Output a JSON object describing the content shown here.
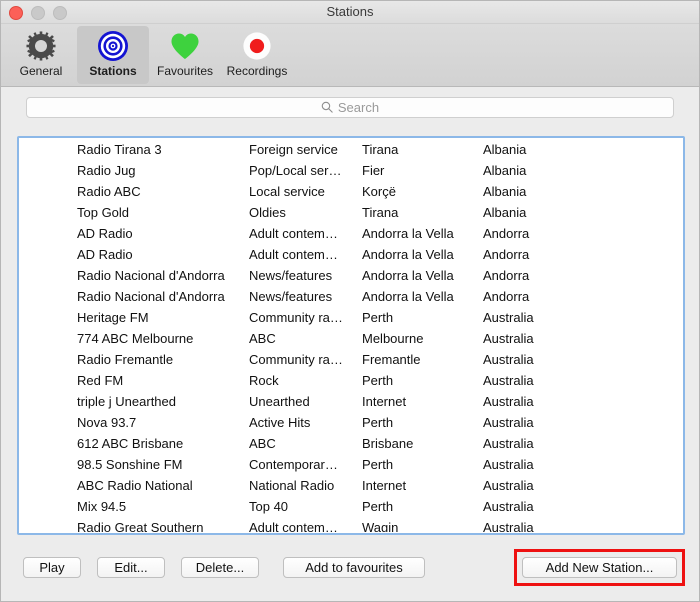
{
  "window": {
    "title": "Stations",
    "traffic_lights": [
      "close-button",
      "minimize-button",
      "zoom-button"
    ]
  },
  "toolbar": {
    "items": [
      {
        "label": "General",
        "icon": "gear-icon",
        "selected": false
      },
      {
        "label": "Stations",
        "icon": "bullseye-icon",
        "selected": true
      },
      {
        "label": "Favourites",
        "icon": "heart-icon",
        "selected": false
      },
      {
        "label": "Recordings",
        "icon": "record-dot-icon",
        "selected": false
      }
    ]
  },
  "search": {
    "icon": "search-icon",
    "placeholder": "Search",
    "value": ""
  },
  "table": {
    "rows": [
      {
        "name": "Radio Tirana 3",
        "genre": "Foreign service",
        "city": "Tirana",
        "country": "Albania"
      },
      {
        "name": "Radio Jug",
        "genre": "Pop/Local ser…",
        "city": "Fier",
        "country": "Albania"
      },
      {
        "name": "Radio ABC",
        "genre": "Local service",
        "city": "Korçë",
        "country": "Albania"
      },
      {
        "name": "Top Gold",
        "genre": "Oldies",
        "city": "Tirana",
        "country": "Albania"
      },
      {
        "name": "AD Radio",
        "genre": "Adult contem…",
        "city": "Andorra la Vella",
        "country": "Andorra"
      },
      {
        "name": "AD Radio",
        "genre": "Adult contem…",
        "city": "Andorra la Vella",
        "country": "Andorra"
      },
      {
        "name": "Radio Nacional d'Andorra",
        "genre": "News/features",
        "city": "Andorra la Vella",
        "country": "Andorra"
      },
      {
        "name": "Radio Nacional d'Andorra",
        "genre": "News/features",
        "city": "Andorra la Vella",
        "country": "Andorra"
      },
      {
        "name": "Heritage FM",
        "genre": "Community ra…",
        "city": "Perth",
        "country": "Australia"
      },
      {
        "name": "774 ABC Melbourne",
        "genre": "ABC",
        "city": "Melbourne",
        "country": "Australia"
      },
      {
        "name": "Radio Fremantle",
        "genre": "Community ra…",
        "city": "Fremantle",
        "country": "Australia"
      },
      {
        "name": "Red FM",
        "genre": "Rock",
        "city": "Perth",
        "country": "Australia"
      },
      {
        "name": "triple j Unearthed",
        "genre": "Unearthed",
        "city": "Internet",
        "country": "Australia"
      },
      {
        "name": "Nova 93.7",
        "genre": "Active Hits",
        "city": "Perth",
        "country": "Australia"
      },
      {
        "name": "612 ABC Brisbane",
        "genre": "ABC",
        "city": "Brisbane",
        "country": "Australia"
      },
      {
        "name": "98.5 Sonshine FM",
        "genre": "Contemporar…",
        "city": "Perth",
        "country": "Australia"
      },
      {
        "name": "ABC Radio National",
        "genre": "National Radio",
        "city": "Internet",
        "country": "Australia"
      },
      {
        "name": "Mix 94.5",
        "genre": "Top 40",
        "city": "Perth",
        "country": "Australia"
      },
      {
        "name": "Radio Great Southern",
        "genre": "Adult contem…",
        "city": "Wagin",
        "country": "Australia"
      }
    ]
  },
  "footer": {
    "play_label": "Play",
    "edit_label": "Edit...",
    "delete_label": "Delete...",
    "add_favourites_label": "Add to favourites",
    "add_new_station_label": "Add New Station..."
  },
  "annotation": {
    "highlight_color": "#ee1111",
    "highlight_target": "add-new-station-button"
  }
}
